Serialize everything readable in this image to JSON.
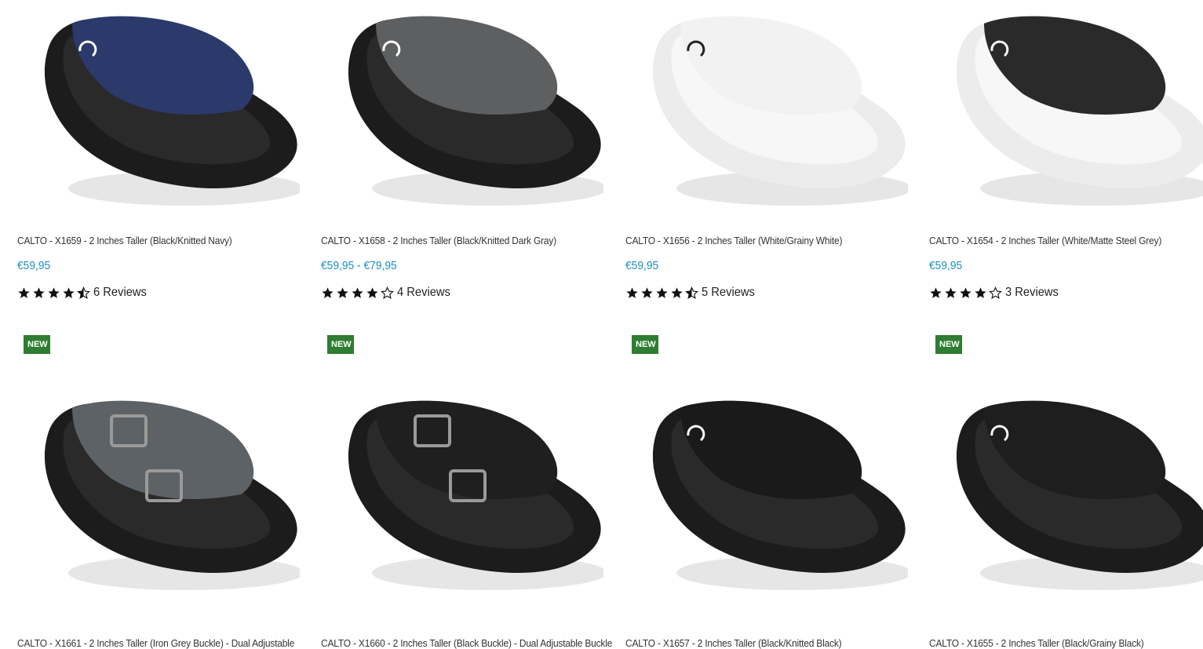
{
  "products_row1": [
    {
      "title": "CALTO - X1659 - 2 Inches Taller (Black/Knitted Navy)",
      "price": "€59,95",
      "rating": 4.5,
      "reviews": "6 Reviews",
      "upper_color": "#2b3a6b",
      "sole_color": "#1c1c1c"
    },
    {
      "title": "CALTO - X1658 - 2 Inches Taller (Black/Knitted Dark Gray)",
      "price": "€59,95 - €79,95",
      "rating": 4.0,
      "reviews": "4 Reviews",
      "upper_color": "#5e5f61",
      "sole_color": "#1c1c1c"
    },
    {
      "title": "CALTO - X1656 - 2 Inches Taller (White/Grainy White)",
      "price": "€59,95",
      "rating": 4.5,
      "reviews": "5 Reviews",
      "upper_color": "#f2f2f2",
      "sole_color": "#ececec"
    },
    {
      "title": "CALTO - X1654 - 2 Inches Taller (White/Matte Steel Grey)",
      "price": "€59,95",
      "rating": 4.0,
      "reviews": "3 Reviews",
      "upper_color": "#2a2a2a",
      "sole_color": "#ececec"
    }
  ],
  "products_row2": [
    {
      "badge": "NEW",
      "title": "CALTO - X1661 - 2 Inches Taller (Iron Grey Buckle) - Dual Adjustable",
      "upper_color": "#5d6266",
      "sole_color": "#1c1c1c"
    },
    {
      "badge": "NEW",
      "title": "CALTO - X1660 - 2 Inches Taller (Black Buckle) - Dual Adjustable Buckle",
      "upper_color": "#1f1f1f",
      "sole_color": "#1c1c1c"
    },
    {
      "badge": "NEW",
      "title": "CALTO - X1657 - 2 Inches Taller (Black/Knitted Black)",
      "upper_color": "#1a1a1a",
      "sole_color": "#1c1c1c"
    },
    {
      "badge": "NEW",
      "title": "CALTO - X1655 - 2 Inches Taller (Black/Grainy Black)",
      "upper_color": "#1e1e1e",
      "sole_color": "#1c1c1c"
    }
  ]
}
